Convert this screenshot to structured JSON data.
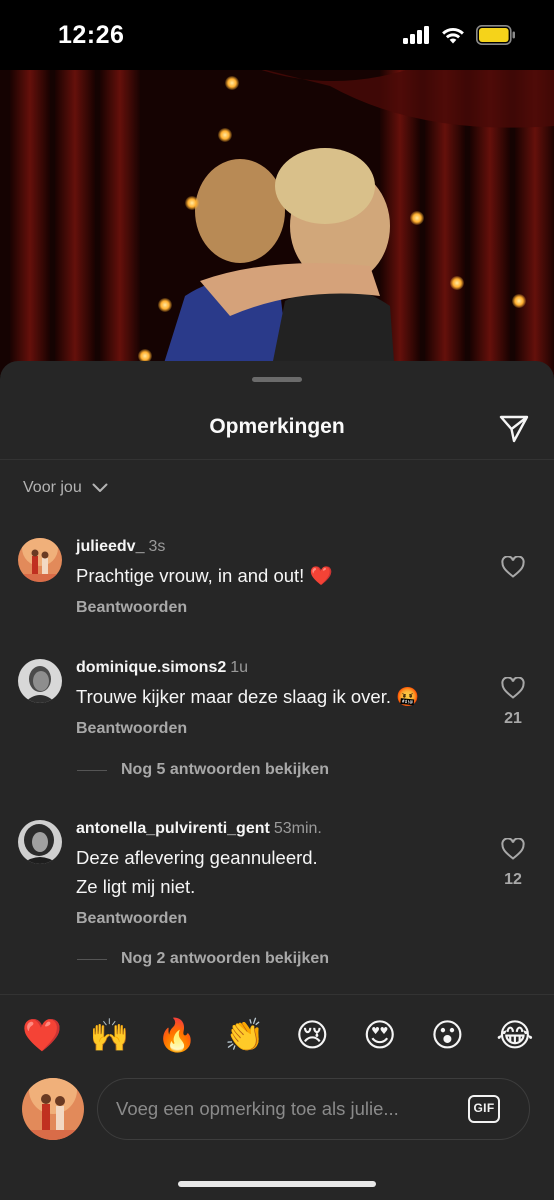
{
  "status_bar": {
    "time": "12:26"
  },
  "sheet": {
    "title": "Opmerkingen",
    "sort_label": "Voor jou"
  },
  "comments": [
    {
      "username": "julieedv_",
      "time": "3s",
      "text": "Prachtige vrouw, in and out! ❤️",
      "reply_label": "Beantwoorden",
      "likes": ""
    },
    {
      "username": "dominique.simons2",
      "time": "1u",
      "text": "Trouwe kijker maar deze slaag ik over. 🤬",
      "reply_label": "Beantwoorden",
      "likes": "21",
      "view_replies": "Nog 5 antwoorden bekijken"
    },
    {
      "username": "antonella_pulvirenti_gent",
      "time": "53min.",
      "text_lines": [
        "Deze aflevering geannuleerd.",
        "Ze ligt mij niet."
      ],
      "reply_label": "Beantwoorden",
      "likes": "12",
      "view_replies": "Nog 2 antwoorden bekijken"
    }
  ],
  "emoji_bar": [
    "❤️",
    "🙌",
    "🔥",
    "👏",
    "😢",
    "😍",
    "😮",
    "😂"
  ],
  "composer": {
    "placeholder": "Voeg een opmerking toe als julie...",
    "gif_label": "GIF"
  },
  "icons": {
    "share": "paper-plane-icon",
    "like": "heart-outline-icon",
    "sort": "chevron-down-icon",
    "signal": "cellular-signal-icon",
    "wifi": "wifi-icon",
    "battery": "battery-icon"
  },
  "colors": {
    "sheet_bg": "#262626",
    "battery": "#f5d31a",
    "heart": "#e0245e"
  }
}
